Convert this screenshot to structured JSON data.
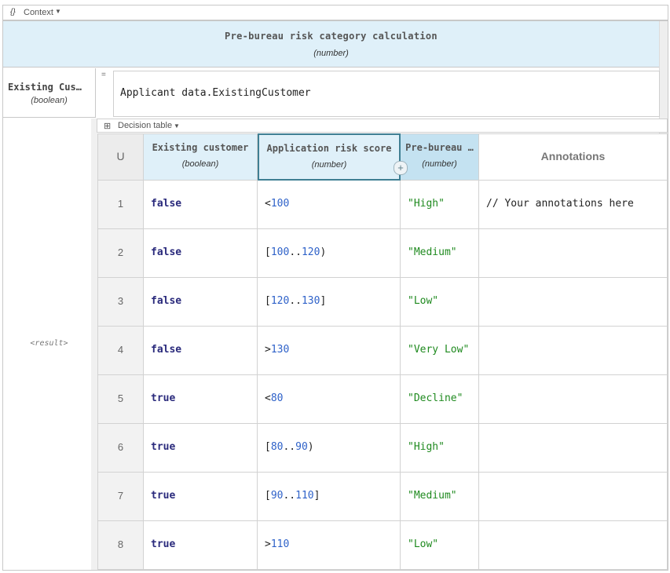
{
  "context_bar": {
    "icon": "{}",
    "label": "Context"
  },
  "boxed_context": {
    "title": "Pre-bureau risk category calculation",
    "type": "(number)"
  },
  "entry": {
    "name": "Existing Cus…",
    "type": "(boolean)",
    "equals": "=",
    "expression": "Applicant data.ExistingCustomer"
  },
  "result_label": "<result>",
  "decision_table": {
    "toolbar_label": "Decision table",
    "hit_policy": "U",
    "columns": [
      {
        "name": "Existing customer",
        "type": "(boolean)",
        "kind": "input"
      },
      {
        "name": "Application risk score",
        "type": "(number)",
        "kind": "input"
      },
      {
        "name": "Pre-bureau …",
        "type": "(number)",
        "kind": "output"
      },
      {
        "name": "Annotations",
        "type": "",
        "kind": "annotation"
      }
    ],
    "rows": [
      {
        "num": "1",
        "existing": "false",
        "score": [
          [
            "op",
            "<"
          ],
          [
            "num",
            "100"
          ]
        ],
        "result": "\"High\"",
        "annotation": "// Your annotations here"
      },
      {
        "num": "2",
        "existing": "false",
        "score": [
          [
            "op",
            "["
          ],
          [
            "num",
            "100"
          ],
          [
            "op",
            ".."
          ],
          [
            "num",
            "120"
          ],
          [
            "op",
            ")"
          ]
        ],
        "result": "\"Medium\"",
        "annotation": ""
      },
      {
        "num": "3",
        "existing": "false",
        "score": [
          [
            "op",
            "["
          ],
          [
            "num",
            "120"
          ],
          [
            "op",
            ".."
          ],
          [
            "num",
            "130"
          ],
          [
            "op",
            "]"
          ]
        ],
        "result": "\"Low\"",
        "annotation": ""
      },
      {
        "num": "4",
        "existing": "false",
        "score": [
          [
            "op",
            ">"
          ],
          [
            "num",
            "130"
          ]
        ],
        "result": "\"Very Low\"",
        "annotation": ""
      },
      {
        "num": "5",
        "existing": "true",
        "score": [
          [
            "op",
            "<"
          ],
          [
            "num",
            "80"
          ]
        ],
        "result": "\"Decline\"",
        "annotation": ""
      },
      {
        "num": "6",
        "existing": "true",
        "score": [
          [
            "op",
            "["
          ],
          [
            "num",
            "80"
          ],
          [
            "op",
            ".."
          ],
          [
            "num",
            "90"
          ],
          [
            "op",
            ")"
          ]
        ],
        "result": "\"High\"",
        "annotation": ""
      },
      {
        "num": "7",
        "existing": "true",
        "score": [
          [
            "op",
            "["
          ],
          [
            "num",
            "90"
          ],
          [
            "op",
            ".."
          ],
          [
            "num",
            "110"
          ],
          [
            "op",
            "]"
          ]
        ],
        "result": "\"Medium\"",
        "annotation": ""
      },
      {
        "num": "8",
        "existing": "true",
        "score": [
          [
            "op",
            ">"
          ],
          [
            "num",
            "110"
          ]
        ],
        "result": "\"Low\"",
        "annotation": ""
      }
    ]
  }
}
